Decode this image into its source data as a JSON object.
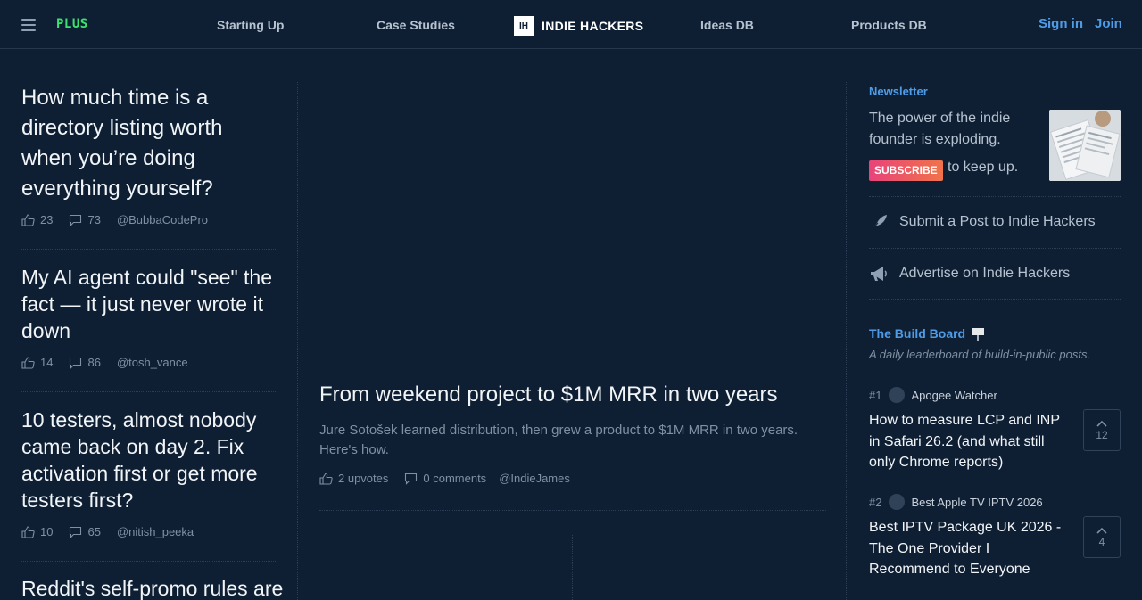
{
  "header": {
    "plus": "PLUS",
    "nav": [
      "Starting Up",
      "Case Studies",
      "Ideas DB",
      "Products DB"
    ],
    "brand_logo": "IH",
    "brand_name": "INDIE HACKERS",
    "signin": "Sign in",
    "join": "Join"
  },
  "left_posts": [
    {
      "title": "How much time is a directory listing worth when you’re doing everything yourself?",
      "upvotes": "23",
      "comments": "73",
      "author": "@BubbaCodePro"
    },
    {
      "title": "My AI agent could \"see\" the fact — it just never wrote it down",
      "upvotes": "14",
      "comments": "86",
      "author": "@tosh_vance"
    },
    {
      "title": "10 testers, almost nobody came back on day 2. Fix activation first or get more testers first?",
      "upvotes": "10",
      "comments": "65",
      "author": "@nitish_peeka"
    },
    {
      "title": "Reddit's self-promo rules are"
    }
  ],
  "featured": {
    "title": "From weekend project to $1M MRR in two years",
    "description": "Jure Sotošek learned distribution, then grew a product to $1M MRR in two years. Here's how.",
    "upvotes": "2 upvotes",
    "comments": "0 comments",
    "author": "@IndieJames"
  },
  "sidebar": {
    "newsletter_label": "Newsletter",
    "newsletter_text": "The power of the indie founder is exploding.",
    "subscribe": "SUBSCRIBE",
    "keep_up": "to keep up.",
    "submit_post": "Submit a Post to Indie Hackers",
    "advertise": "Advertise on Indie Hackers",
    "build_board_label": "The Build Board",
    "build_board_sub": "A daily leaderboard of build-in-public posts.",
    "build_board": [
      {
        "rank": "#1",
        "name": "Apogee Watcher",
        "title": "How to measure LCP and INP in Safari 26.2 (and what still only Chrome reports)",
        "votes": "12"
      },
      {
        "rank": "#2",
        "name": "Best Apple TV IPTV 2026",
        "title": "Best IPTV Package UK 2026 - The One Provider I Recommend to Everyone",
        "votes": "4"
      }
    ]
  },
  "colors": {
    "background": "#0f1f33",
    "accent_blue": "#4e9ce8",
    "plus_green": "#3be26f",
    "subscribe_gradient_start": "#e8437a",
    "subscribe_gradient_end": "#f0734a"
  },
  "icons": [
    "hamburger-icon",
    "thumbs-up-icon",
    "comment-icon",
    "quill-icon",
    "megaphone-icon",
    "signpost-icon",
    "chevron-up-icon"
  ]
}
